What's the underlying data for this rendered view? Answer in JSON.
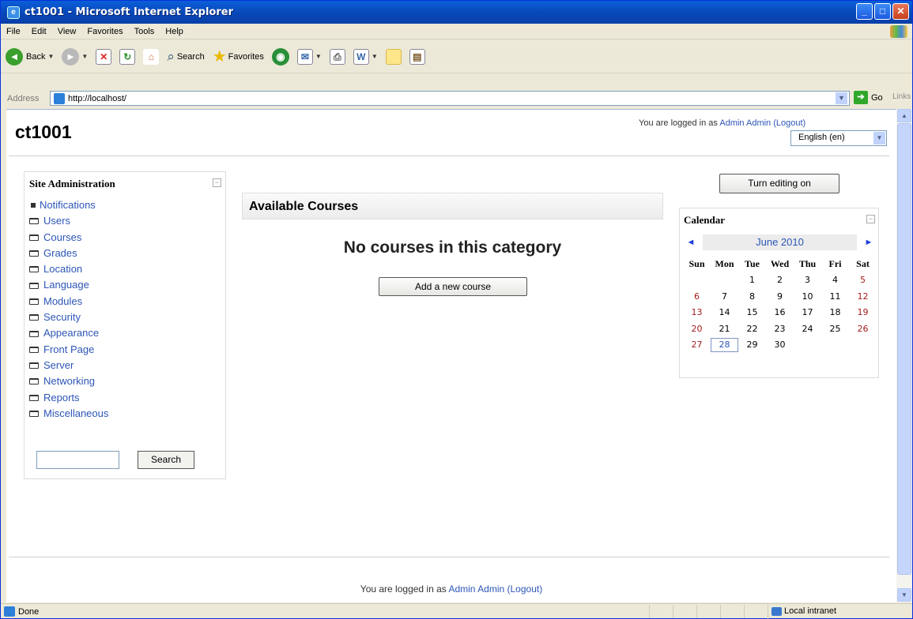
{
  "window": {
    "title": "ct1001 - Microsoft Internet Explorer",
    "minimize": "_",
    "maximize": "□",
    "close": "✕"
  },
  "menu": [
    "File",
    "Edit",
    "View",
    "Favorites",
    "Tools",
    "Help"
  ],
  "toolbar": {
    "back": "Back",
    "search": "Search",
    "favorites": "Favorites"
  },
  "address": {
    "label": "Address",
    "url": "http://localhost/",
    "go": "Go",
    "links": "Links"
  },
  "page": {
    "site_name": "ct1001",
    "logged_prefix": "You are logged in as ",
    "user": "Admin Admin",
    "logout": "(Logout)",
    "language": "English (en)"
  },
  "admin_block": {
    "title": "Site Administration",
    "items": [
      "Notifications",
      "Users",
      "Courses",
      "Grades",
      "Location",
      "Language",
      "Modules",
      "Security",
      "Appearance",
      "Front Page",
      "Server",
      "Networking",
      "Reports",
      "Miscellaneous"
    ],
    "search_button": "Search",
    "search_value": ""
  },
  "main": {
    "heading": "Available Courses",
    "empty_message": "No courses in this category",
    "add_button": "Add a new course"
  },
  "edit_button": "Turn editing on",
  "calendar": {
    "title": "Calendar",
    "month": "June 2010",
    "prev": "◄",
    "next": "►",
    "days": [
      "Sun",
      "Mon",
      "Tue",
      "Wed",
      "Thu",
      "Fri",
      "Sat"
    ],
    "weeks": [
      [
        "",
        "",
        "1",
        "2",
        "3",
        "4",
        "5"
      ],
      [
        "6",
        "7",
        "8",
        "9",
        "10",
        "11",
        "12"
      ],
      [
        "13",
        "14",
        "15",
        "16",
        "17",
        "18",
        "19"
      ],
      [
        "20",
        "21",
        "22",
        "23",
        "24",
        "25",
        "26"
      ],
      [
        "27",
        "28",
        "29",
        "30",
        "",
        "",
        ""
      ]
    ],
    "today": "28"
  },
  "status": {
    "text": "Done",
    "zone": "Local intranet"
  }
}
